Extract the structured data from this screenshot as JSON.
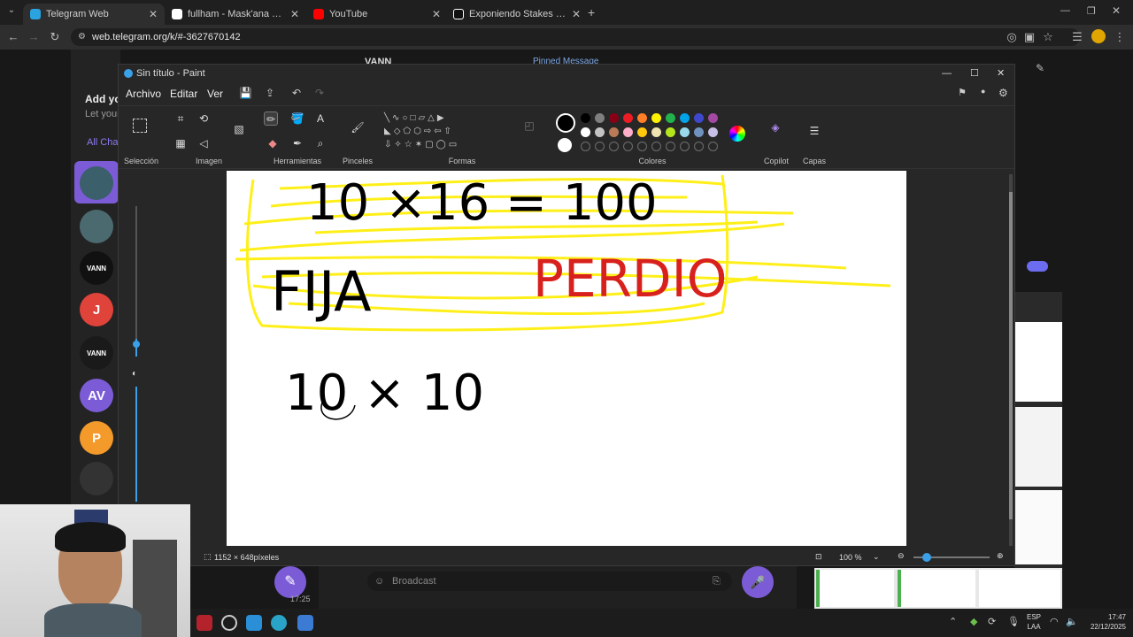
{
  "browser": {
    "tabs": [
      {
        "label": "Telegram Web",
        "color": "#2aa3e0"
      },
      {
        "label": "fullham - Mask'ana Google",
        "color": "#ffffff"
      },
      {
        "label": "YouTube",
        "color": "#ff0000"
      },
      {
        "label": "Exponiendo Stakes y Grupos V",
        "color": "#ffffff"
      }
    ],
    "url": "web.telegram.org/k/#-3627670142"
  },
  "telegram": {
    "top_title": "VANN",
    "pinned": "Pinned Message",
    "left_text_1": "Add you",
    "left_text_2": "Let your",
    "all_chats": "All Cha",
    "chat_avatars": [
      {
        "label": "",
        "color": "#3b5f6b"
      },
      {
        "label": "",
        "color": "#4b6a70"
      },
      {
        "label": "VANN",
        "color": "#111111"
      },
      {
        "label": "J",
        "color": "#e0433a"
      },
      {
        "label": "VANN",
        "color": "#1a1a1a"
      },
      {
        "label": "AV",
        "color": "#7b5cd6"
      },
      {
        "label": "P",
        "color": "#f39a2b"
      },
      {
        "label": "",
        "color": "#333333"
      }
    ],
    "voice_label": "oice",
    "broadcast_placeholder": "Broadcast",
    "time_small": "17:25"
  },
  "paint": {
    "title": "Sin título - Paint",
    "menu": [
      "Archivo",
      "Editar",
      "Ver"
    ],
    "groups": [
      "Selección",
      "Imagen",
      "Herramientas",
      "Pinceles",
      "Formas",
      "Colores",
      "Copilot",
      "Capas"
    ],
    "palette_row1": [
      "#000000",
      "#7f7f7f",
      "#880015",
      "#ed1c24",
      "#ff7f27",
      "#fff200",
      "#22b14c",
      "#00a2e8",
      "#3f48cc",
      "#a349a4"
    ],
    "palette_row2": [
      "#ffffff",
      "#c3c3c3",
      "#b97a57",
      "#ffaec9",
      "#ffc90e",
      "#efe4b0",
      "#b5e61d",
      "#99d9ea",
      "#7092be",
      "#c8bfe7"
    ],
    "canvas_text": {
      "line1": "10 ×16 = 100",
      "word_fija": "FIJA",
      "word_perdio": "PERDIO",
      "line3": "10 × 10"
    },
    "status": {
      "size": "1152 × 648píxeles",
      "zoom": "100 %"
    }
  },
  "taskbar": {
    "lang1": "ESP",
    "lang2": "LAA",
    "time": "17:47",
    "date": "22/12/2025"
  }
}
